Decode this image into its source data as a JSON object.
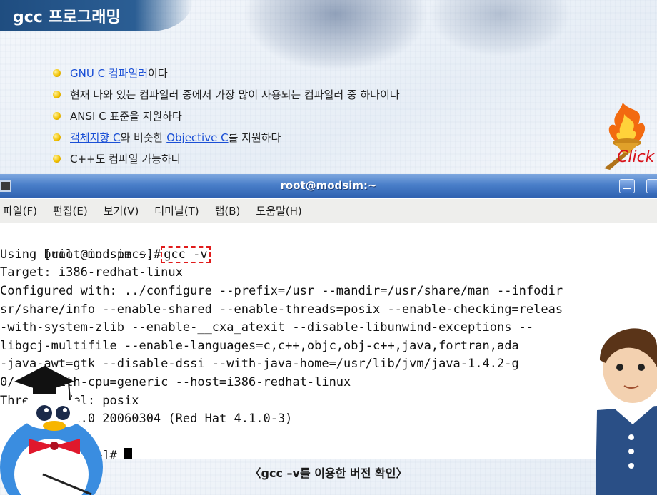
{
  "page": {
    "title": "gcc 프로그래밍",
    "caption": "〈gcc –v를 이용한 버전 확인〉",
    "click_label": "Click"
  },
  "bullets": [
    {
      "parts": [
        {
          "text": "GNU C 컴파일러",
          "link": true
        },
        {
          "text": "이다",
          "link": false
        }
      ]
    },
    {
      "parts": [
        {
          "text": "현재 나와 있는 컴파일러 중에서 가장 많이 사용되는 컴파일러 중 하나이다",
          "link": false
        }
      ]
    },
    {
      "parts": [
        {
          "text": "ANSI C 표준을 지원하다",
          "link": false
        }
      ]
    },
    {
      "parts": [
        {
          "text": "객체지향 C",
          "link": true
        },
        {
          "text": "와 비슷한 ",
          "link": false
        },
        {
          "text": "Objective C",
          "link": true
        },
        {
          "text": "를 지원하다",
          "link": false
        }
      ]
    },
    {
      "parts": [
        {
          "text": "C++도 컴파일 가능하다",
          "link": false
        }
      ]
    }
  ],
  "terminal": {
    "title": "root@modsim:~",
    "menu": [
      "파일(F)",
      "편집(E)",
      "보기(V)",
      "터미널(T)",
      "탭(B)",
      "도움말(H)"
    ],
    "prompt1": "[root@modsim ~]#",
    "command": "gcc -v",
    "lines": [
      "Using built-in specs.",
      "Target: i386-redhat-linux",
      "Configured with: ../configure --prefix=/usr --mandir=/usr/share/man --infodir",
      "sr/share/info --enable-shared --enable-threads=posix --enable-checking=releas",
      "-with-system-zlib --enable-__cxa_atexit --disable-libunwind-exceptions --",
      "libgcj-multifile --enable-languages=c,c++,objc,obj-c++,java,fortran,ada",
      "-java-awt=gtk --disable-dssi --with-java-home=/usr/lib/jvm/java-1.4.2-g",
      "0/   --with-cpu=generic --host=i386-redhat-linux",
      "Thread model: posix",
      "     on 4.1.0 20060304 (Red Hat 4.1.0-3)"
    ],
    "prompt2": "     m ~]# "
  },
  "colors": {
    "title_bar": "#2b5e94",
    "terminal_titlebar": "#4a7fc9",
    "link": "#1a4fd6",
    "highlight": "#e01b1b",
    "click": "#d8141b"
  }
}
